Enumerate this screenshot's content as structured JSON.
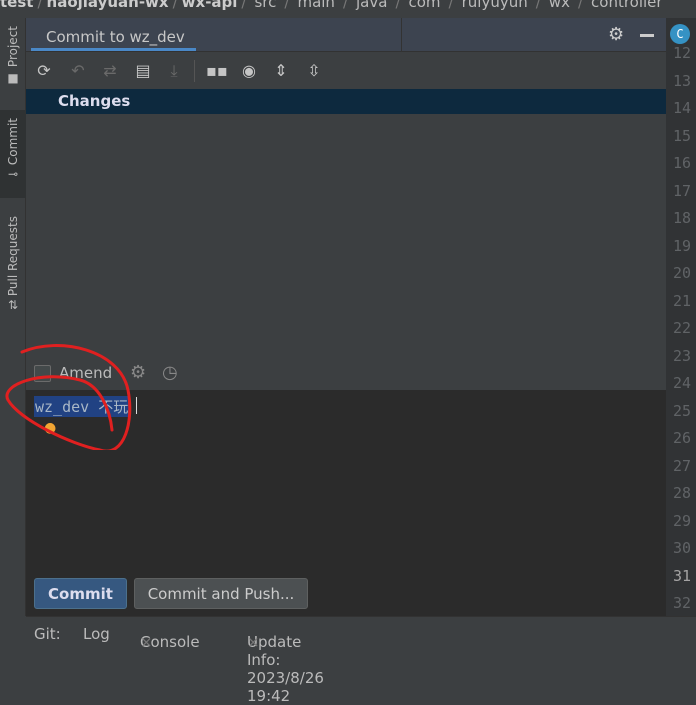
{
  "breadcrumb": [
    "test",
    "haojiayuan-wx",
    "wx-api",
    "src",
    "main",
    "java",
    "com",
    "ruiyuyun",
    "wx",
    "controller"
  ],
  "left_tabs": [
    {
      "label": "Project",
      "icon": "folder-icon"
    },
    {
      "label": "Commit",
      "icon": "commit-icon"
    },
    {
      "label": "Pull Requests",
      "icon": "pull-request-icon"
    }
  ],
  "panel": {
    "title": "Commit to wz_dev"
  },
  "toolbar": [
    {
      "icon": "refresh-icon",
      "enabled": true
    },
    {
      "icon": "rollback-icon",
      "enabled": false
    },
    {
      "icon": "show-diff-icon",
      "enabled": false
    },
    {
      "icon": "changelist-icon",
      "enabled": true
    },
    {
      "icon": "shelve-icon",
      "enabled": false
    },
    {
      "icon": "group-by-icon",
      "enabled": true
    },
    {
      "icon": "view-options-icon",
      "enabled": true
    },
    {
      "icon": "expand-all-icon",
      "enabled": true
    },
    {
      "icon": "collapse-all-icon",
      "enabled": true
    }
  ],
  "changes": {
    "label": "Changes"
  },
  "amend": {
    "label": "Amend",
    "checked": false
  },
  "message": {
    "value": "wz_dev 不玩"
  },
  "buttons": {
    "commit": "Commit",
    "commit_push": "Commit and Push..."
  },
  "gutter": {
    "lines": [
      "12",
      "13",
      "14",
      "15",
      "16",
      "17",
      "18",
      "19",
      "20",
      "21",
      "22",
      "23",
      "24",
      "25",
      "26",
      "27",
      "28",
      "29",
      "30",
      "31",
      "32"
    ],
    "current": "31"
  },
  "bottom": {
    "git": "Git:",
    "log": "Log",
    "console": "Console",
    "update": "Update Info: 2023/8/26 19:42",
    "close": "×"
  },
  "colors": {
    "accent": "#4a88c7",
    "primary_button": "#365880",
    "selection": "#214283",
    "annotation": "#e02020"
  }
}
